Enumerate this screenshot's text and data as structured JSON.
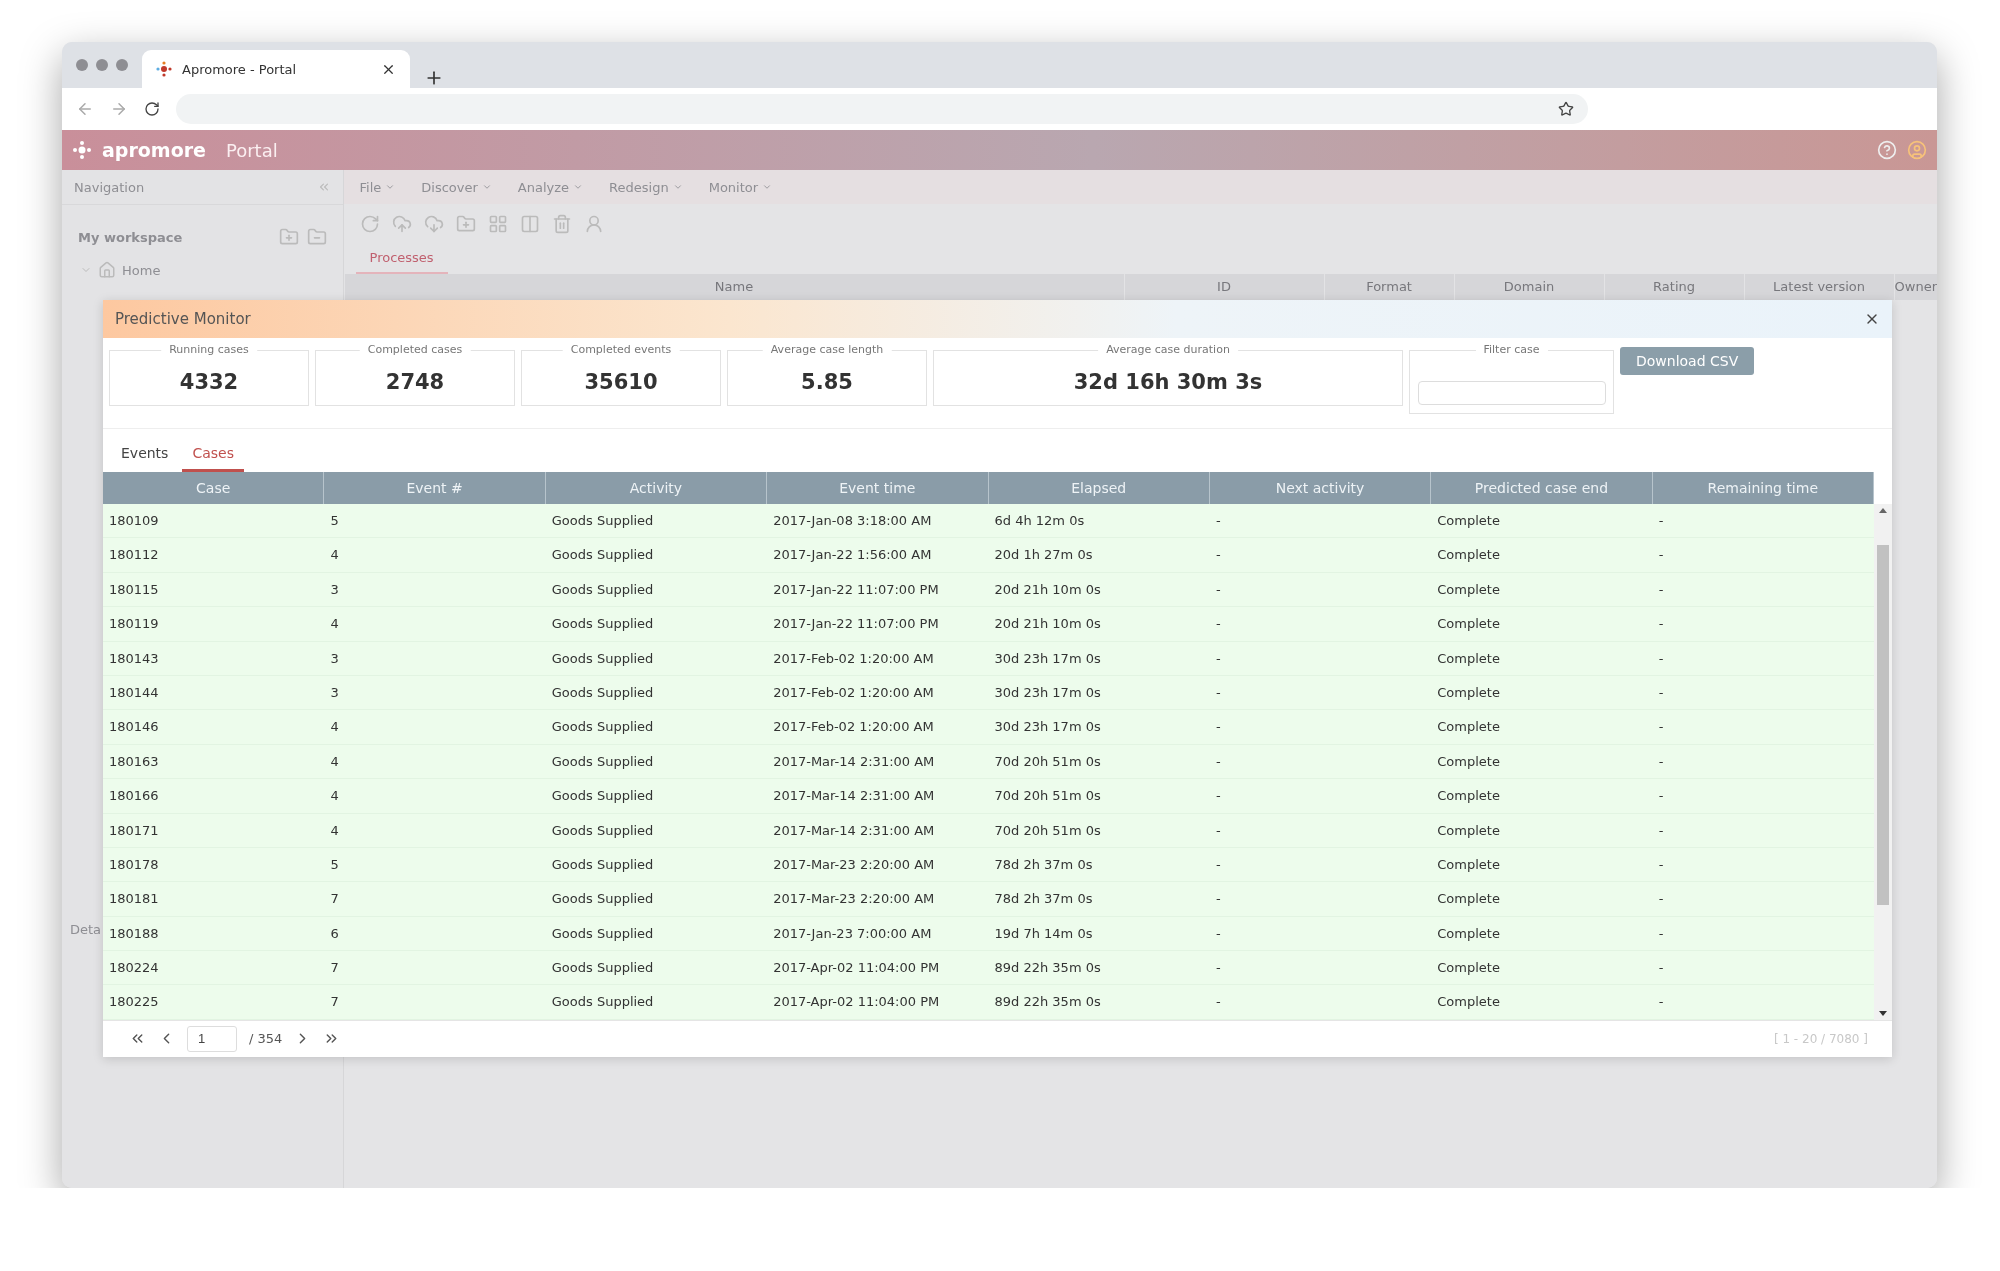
{
  "browser": {
    "tab_title": "Apromore - Portal"
  },
  "app": {
    "brand": "apromore",
    "product": "Portal",
    "navigation": {
      "title": "Navigation",
      "workspace": "My workspace",
      "tree": [
        {
          "label": "Home",
          "expanded": true
        }
      ],
      "details": "Deta"
    },
    "menu": [
      "File",
      "Discover",
      "Analyze",
      "Redesign",
      "Monitor"
    ],
    "tabs": [
      {
        "label": "Processes",
        "selected": true
      }
    ],
    "columns": [
      "Name",
      "ID",
      "Format",
      "Domain",
      "Rating",
      "Latest version",
      "Owner"
    ]
  },
  "dialog": {
    "title": "Predictive Monitor",
    "stats": [
      {
        "label": "Running cases",
        "value": "4332"
      },
      {
        "label": "Completed cases",
        "value": "2748"
      },
      {
        "label": "Completed events",
        "value": "35610"
      },
      {
        "label": "Average case length",
        "value": "5.85"
      },
      {
        "label": "Average case duration",
        "value": "32d 16h 30m 3s"
      }
    ],
    "filter": {
      "label": "Filter case"
    },
    "download_button": "Download CSV",
    "tabs": [
      {
        "label": "Events",
        "selected": false
      },
      {
        "label": "Cases",
        "selected": true
      }
    ],
    "columns": [
      "Case",
      "Event #",
      "Activity",
      "Event time",
      "Elapsed",
      "Next activity",
      "Predicted case end",
      "Remaining time"
    ],
    "rows": [
      [
        "180109",
        "5",
        "Goods Supplied",
        "2017-Jan-08 3:18:00 AM",
        "6d 4h 12m 0s",
        "-",
        "Complete",
        "-"
      ],
      [
        "180112",
        "4",
        "Goods Supplied",
        "2017-Jan-22 1:56:00 AM",
        "20d 1h 27m 0s",
        "-",
        "Complete",
        "-"
      ],
      [
        "180115",
        "3",
        "Goods Supplied",
        "2017-Jan-22 11:07:00 PM",
        "20d 21h 10m 0s",
        "-",
        "Complete",
        "-"
      ],
      [
        "180119",
        "4",
        "Goods Supplied",
        "2017-Jan-22 11:07:00 PM",
        "20d 21h 10m 0s",
        "-",
        "Complete",
        "-"
      ],
      [
        "180143",
        "3",
        "Goods Supplied",
        "2017-Feb-02 1:20:00 AM",
        "30d 23h 17m 0s",
        "-",
        "Complete",
        "-"
      ],
      [
        "180144",
        "3",
        "Goods Supplied",
        "2017-Feb-02 1:20:00 AM",
        "30d 23h 17m 0s",
        "-",
        "Complete",
        "-"
      ],
      [
        "180146",
        "4",
        "Goods Supplied",
        "2017-Feb-02 1:20:00 AM",
        "30d 23h 17m 0s",
        "-",
        "Complete",
        "-"
      ],
      [
        "180163",
        "4",
        "Goods Supplied",
        "2017-Mar-14 2:31:00 AM",
        "70d 20h 51m 0s",
        "-",
        "Complete",
        "-"
      ],
      [
        "180166",
        "4",
        "Goods Supplied",
        "2017-Mar-14 2:31:00 AM",
        "70d 20h 51m 0s",
        "-",
        "Complete",
        "-"
      ],
      [
        "180171",
        "4",
        "Goods Supplied",
        "2017-Mar-14 2:31:00 AM",
        "70d 20h 51m 0s",
        "-",
        "Complete",
        "-"
      ],
      [
        "180178",
        "5",
        "Goods Supplied",
        "2017-Mar-23 2:20:00 AM",
        "78d 2h 37m 0s",
        "-",
        "Complete",
        "-"
      ],
      [
        "180181",
        "7",
        "Goods Supplied",
        "2017-Mar-23 2:20:00 AM",
        "78d 2h 37m 0s",
        "-",
        "Complete",
        "-"
      ],
      [
        "180188",
        "6",
        "Goods Supplied",
        "2017-Jan-23 7:00:00 AM",
        "19d 7h 14m 0s",
        "-",
        "Complete",
        "-"
      ],
      [
        "180224",
        "7",
        "Goods Supplied",
        "2017-Apr-02 11:04:00 PM",
        "89d 22h 35m 0s",
        "-",
        "Complete",
        "-"
      ],
      [
        "180225",
        "7",
        "Goods Supplied",
        "2017-Apr-02 11:04:00 PM",
        "89d 22h 35m 0s",
        "-",
        "Complete",
        "-"
      ]
    ],
    "pagination": {
      "page": "1",
      "total": "/ 354",
      "range": "[ 1 - 20 / 7080 ]"
    }
  }
}
